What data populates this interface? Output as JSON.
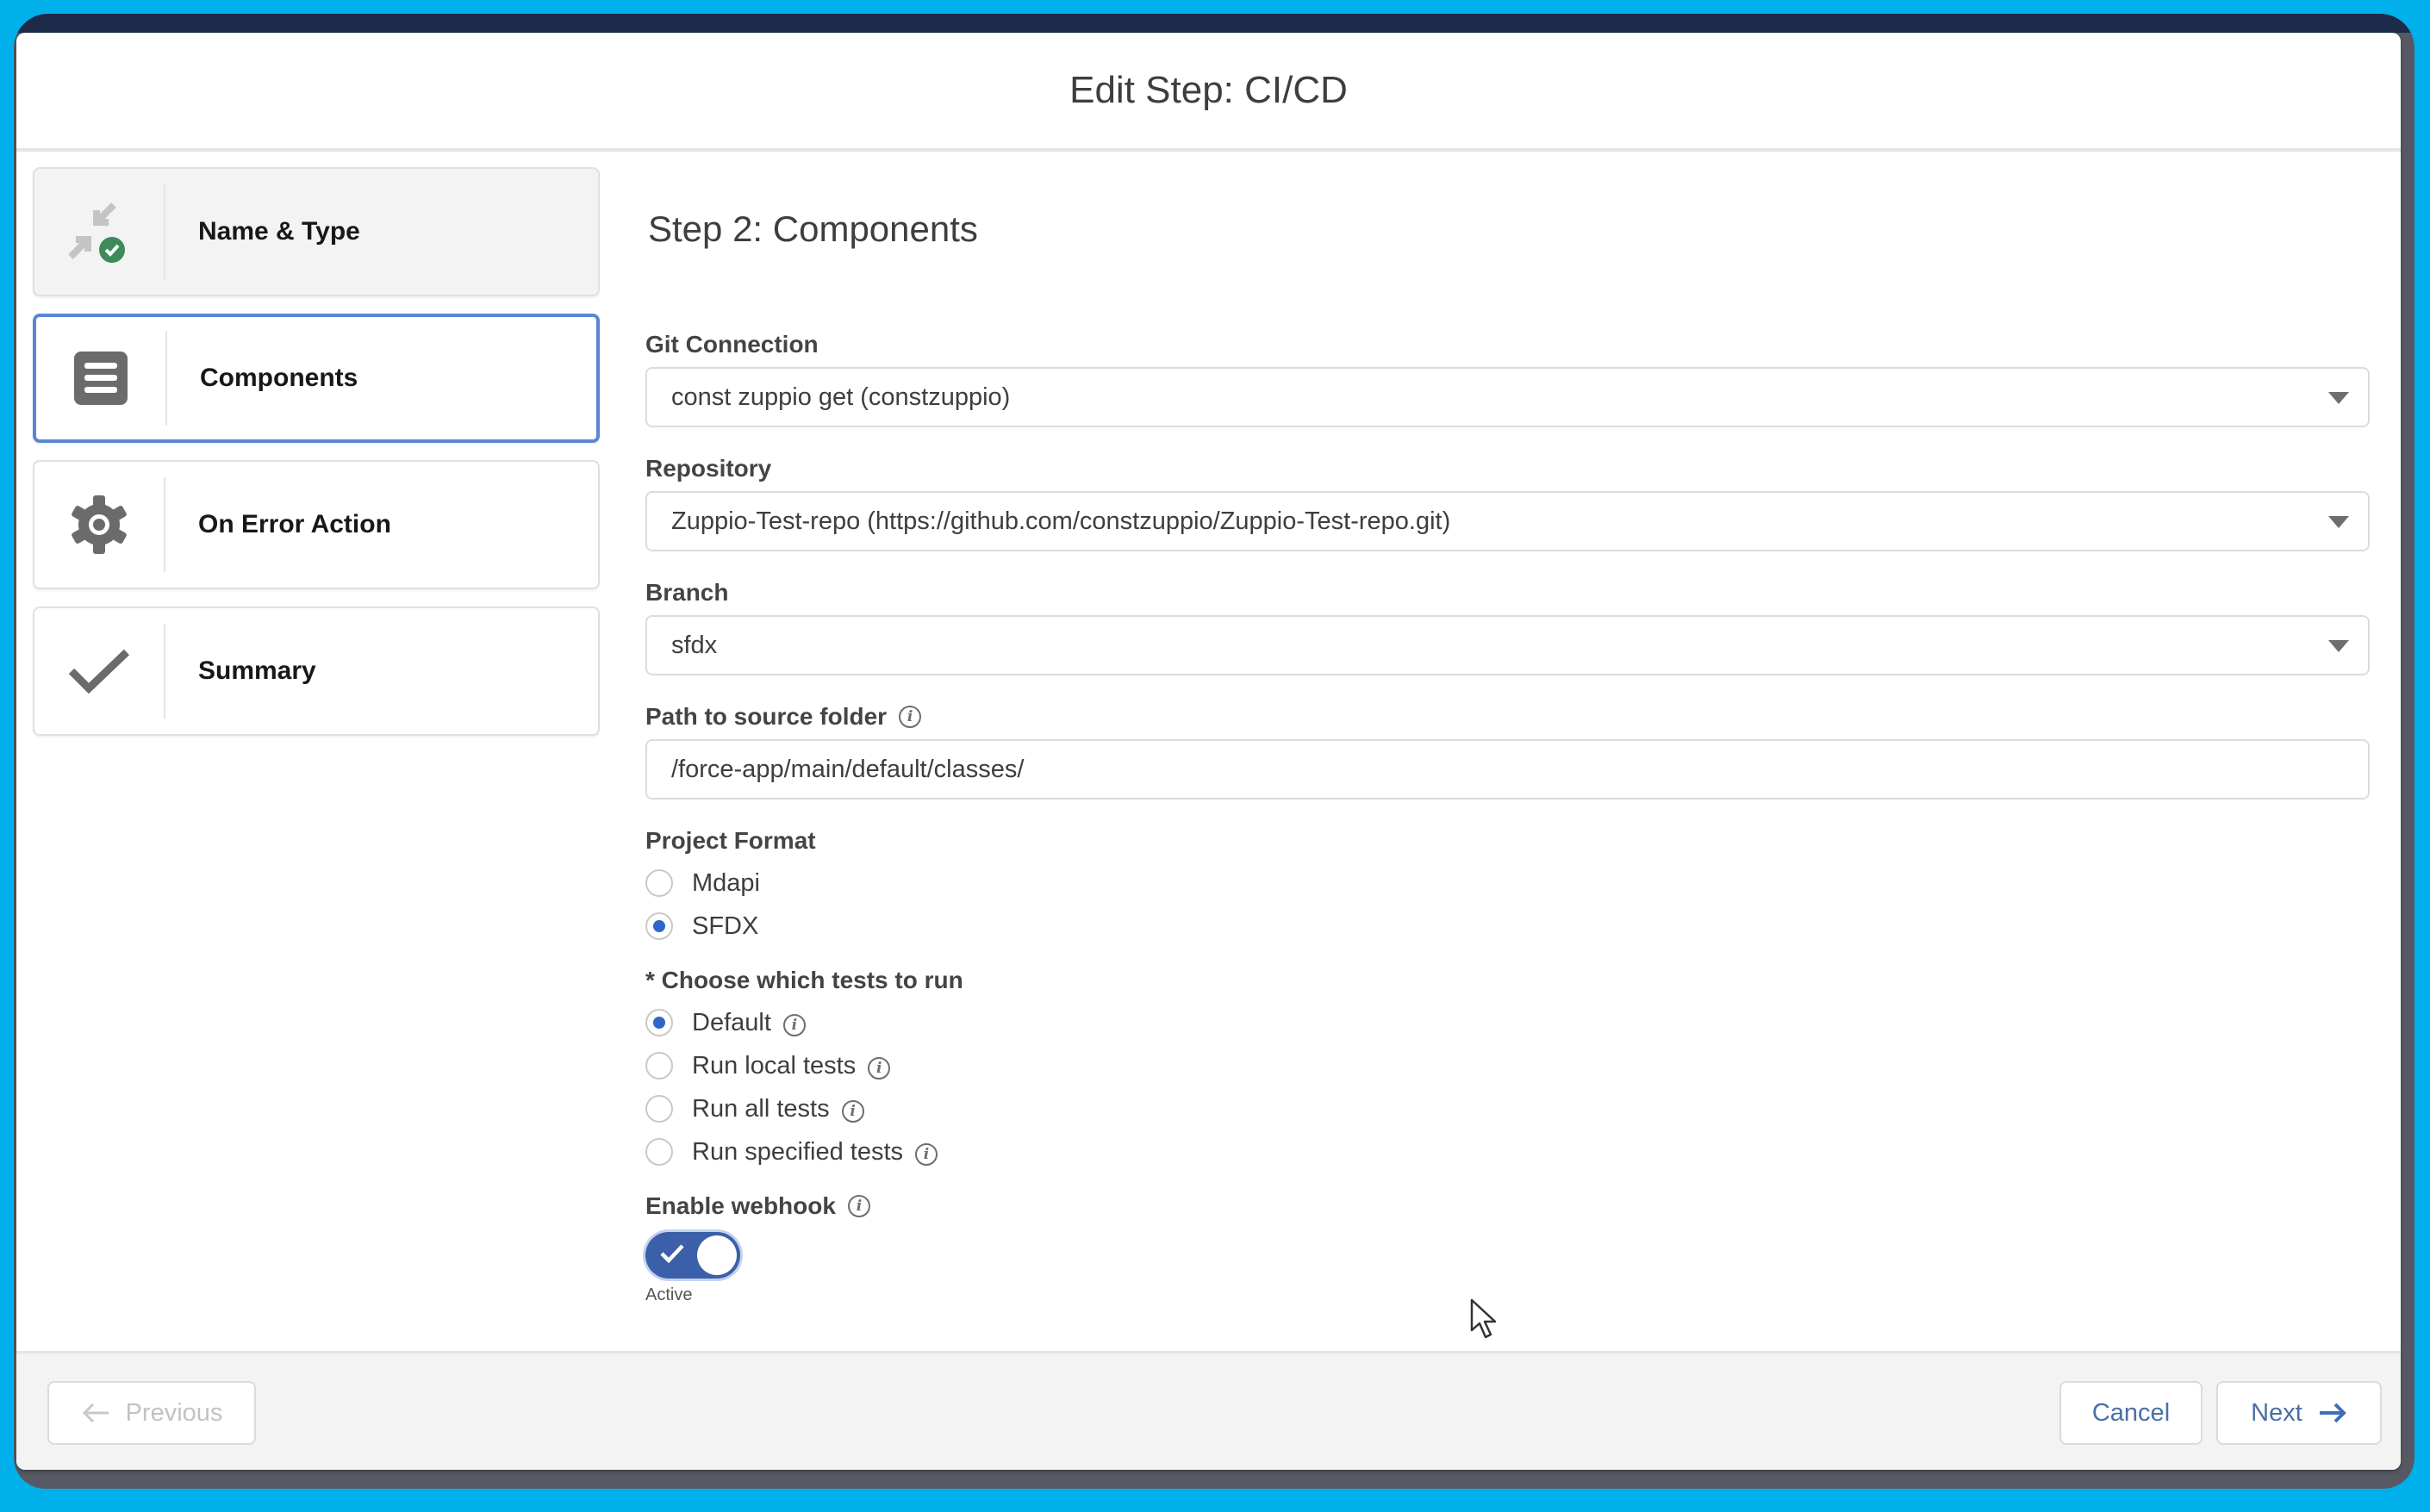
{
  "modal": {
    "title": "Edit Step: CI/CD"
  },
  "sidebar": {
    "steps": [
      {
        "label": "Name & Type",
        "icon": "compress-arrows-icon",
        "status": "completed"
      },
      {
        "label": "Components",
        "icon": "list-document-icon",
        "status": "active"
      },
      {
        "label": "On Error Action",
        "icon": "gear-icon",
        "status": "pending"
      },
      {
        "label": "Summary",
        "icon": "checkmark-icon",
        "status": "pending"
      }
    ]
  },
  "form": {
    "step_title": "Step 2: Components",
    "git_connection": {
      "label": "Git Connection",
      "value": "const zuppio get (constzuppio)"
    },
    "repository": {
      "label": "Repository",
      "value": "Zuppio-Test-repo (https://github.com/constzuppio/Zuppio-Test-repo.git)"
    },
    "branch": {
      "label": "Branch",
      "value": "sfdx"
    },
    "path": {
      "label": "Path to source folder",
      "value": "/force-app/main/default/classes/"
    },
    "project_format": {
      "label": "Project Format",
      "options": [
        {
          "label": "Mdapi",
          "checked": false
        },
        {
          "label": "SFDX",
          "checked": true
        }
      ]
    },
    "tests": {
      "label": "* Choose which tests to run",
      "options": [
        {
          "label": "Default",
          "checked": true
        },
        {
          "label": "Run local tests",
          "checked": false
        },
        {
          "label": "Run all tests",
          "checked": false
        },
        {
          "label": "Run specified tests",
          "checked": false
        }
      ]
    },
    "webhook": {
      "label": "Enable webhook",
      "enabled": true,
      "caption": "Active"
    }
  },
  "footer": {
    "previous_label": "Previous",
    "cancel_label": "Cancel",
    "next_label": "Next"
  },
  "colors": {
    "frame": "#00b0ea",
    "active_border": "#5a86d4",
    "radio_checked": "#2f67c8",
    "toggle_on": "#3b5fa8",
    "success": "#3f8a5a",
    "button_text": "#4a6fa5"
  }
}
